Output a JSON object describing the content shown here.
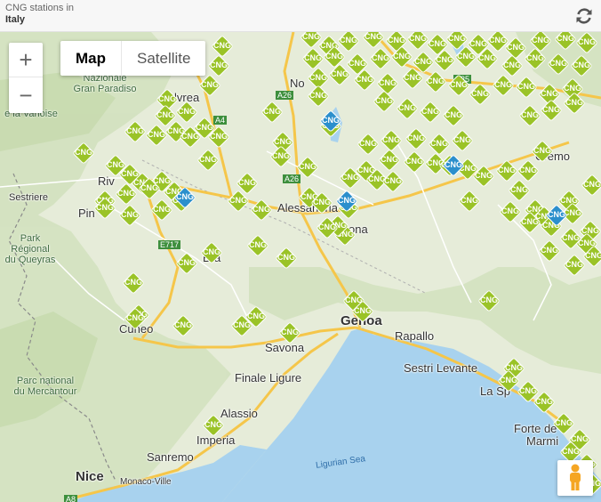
{
  "header": {
    "subtitle": "CNG stations in",
    "region": "Italy",
    "refresh_icon": "refresh-icon"
  },
  "controls": {
    "zoom_in": "+",
    "zoom_out": "−",
    "map_types": [
      "Map",
      "Satellite"
    ],
    "active_map_type": "Map",
    "pegman_icon": "street-view-pegman-icon"
  },
  "map": {
    "sea_label": "Ligurian Sea",
    "marker_label": "CNG",
    "colors": {
      "land": "#e6ecd9",
      "sea": "#a8d2ee",
      "marker": "#9ac327",
      "highway": "#f5c64a",
      "road": "#ffffff",
      "border": "#8a8a8a"
    },
    "cities": [
      {
        "key": "genoa",
        "name": "Genoa",
        "big": true
      },
      {
        "key": "savona",
        "name": "Savona"
      },
      {
        "key": "rapallo",
        "name": "Rapallo"
      },
      {
        "key": "sestri",
        "name": "Sestri Levante"
      },
      {
        "key": "laspezia",
        "name": "La Sp"
      },
      {
        "key": "forte",
        "name": "Forte de"
      },
      {
        "key": "marmi",
        "name": "Marmi"
      },
      {
        "key": "finale",
        "name": "Finale Ligure"
      },
      {
        "key": "alassio",
        "name": "Alassio"
      },
      {
        "key": "imperia",
        "name": "Imperia"
      },
      {
        "key": "sanremo",
        "name": "Sanremo"
      },
      {
        "key": "nice",
        "name": "Nice",
        "big": true
      },
      {
        "key": "monaco",
        "name": "Monaco-Ville"
      },
      {
        "key": "cuneo",
        "name": "Cuneo"
      },
      {
        "key": "alessandria",
        "name": "Alessandria"
      },
      {
        "key": "pinerolo",
        "name": "Pin"
      },
      {
        "key": "riv",
        "name": "Riv"
      },
      {
        "key": "cremona",
        "name": "Cremo"
      },
      {
        "key": "lvrea",
        "name": "lvrea"
      },
      {
        "key": "sestriere",
        "name": "Sestriere"
      },
      {
        "key": "bra",
        "name": "Bra"
      },
      {
        "key": "ona",
        "name": "ona"
      },
      {
        "key": "no",
        "name": "No"
      }
    ],
    "parks": [
      {
        "key": "granparadiso",
        "name": "Nazionale\nGran Paradiso"
      },
      {
        "key": "vanoise",
        "name": "e la Vanoise"
      },
      {
        "key": "queyras",
        "name": "Park\nRégional\ndu Queyras"
      },
      {
        "key": "mercantour",
        "name": "Parc national\ndu Mercantour"
      }
    ],
    "road_shields": [
      "A26",
      "A4",
      "A26",
      "E717",
      "A35",
      "A8"
    ]
  }
}
